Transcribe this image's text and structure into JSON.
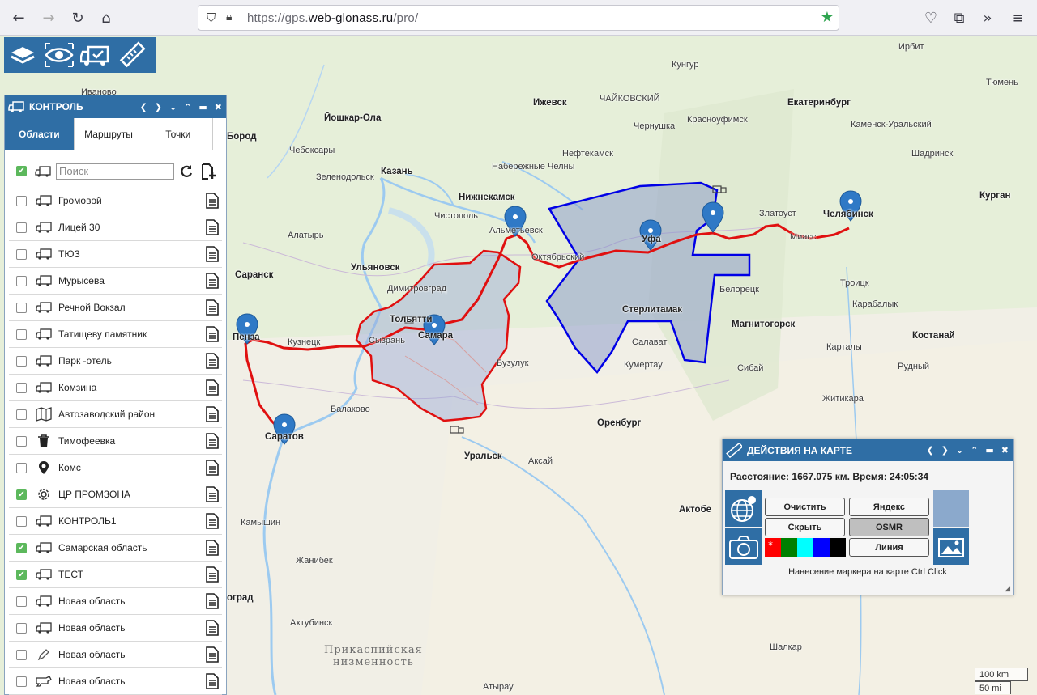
{
  "browser": {
    "url_prefix": "https://gps.",
    "url_domain": "web-glonass.ru",
    "url_path": "/pro/"
  },
  "map": {
    "cities": [
      {
        "name": "Кунгур"
      },
      {
        "name": "Ирбит"
      },
      {
        "name": "Тюмень"
      },
      {
        "name": "Ижевск"
      },
      {
        "name": "ЧАЙКОВСКИЙ"
      },
      {
        "name": "Екатеринбург"
      },
      {
        "name": "Йошкар-Ола"
      },
      {
        "name": "Чернушка"
      },
      {
        "name": "Красноуфимск"
      },
      {
        "name": "Каменск-Уральский"
      },
      {
        "name": "Чебоксары"
      },
      {
        "name": "Набережные Челны"
      },
      {
        "name": "Нефтекамск"
      },
      {
        "name": "Шадринск"
      },
      {
        "name": "Казань"
      },
      {
        "name": "Зеленодольск"
      },
      {
        "name": "Нижнекамск"
      },
      {
        "name": "Курган"
      },
      {
        "name": "Чистополь"
      },
      {
        "name": "Златоуст"
      },
      {
        "name": "Челябинск"
      },
      {
        "name": "Альметьевск"
      },
      {
        "name": "Уфа"
      },
      {
        "name": "Миасс"
      },
      {
        "name": "Алатырь"
      },
      {
        "name": "Октябрьский"
      },
      {
        "name": "Саранск"
      },
      {
        "name": "Ульяновск"
      },
      {
        "name": "Димитровград"
      },
      {
        "name": "Белорецк"
      },
      {
        "name": "Троицк"
      },
      {
        "name": "Стерлитамак"
      },
      {
        "name": "Тольятти"
      },
      {
        "name": "Самара"
      },
      {
        "name": "Магнитогорск"
      },
      {
        "name": "Карабалык"
      },
      {
        "name": "Пенза"
      },
      {
        "name": "Кузнецк"
      },
      {
        "name": "Сызрань"
      },
      {
        "name": "Салават"
      },
      {
        "name": "Костанай"
      },
      {
        "name": "Карталы"
      },
      {
        "name": "Бузулук"
      },
      {
        "name": "Кумертау"
      },
      {
        "name": "Сибай"
      },
      {
        "name": "Рудный"
      },
      {
        "name": "Балаково"
      },
      {
        "name": "Житикара"
      },
      {
        "name": "Саратов"
      },
      {
        "name": "Оренбург"
      },
      {
        "name": "Уральск"
      },
      {
        "name": "Аксай"
      },
      {
        "name": "Актобе"
      },
      {
        "name": "Камышин"
      },
      {
        "name": "Жанибек"
      },
      {
        "name": "Ахтубинск"
      },
      {
        "name": "Шалкар"
      },
      {
        "name": "Атырау"
      },
      {
        "name": "Бород"
      },
      {
        "name": "Иваново"
      },
      {
        "name": "оград"
      }
    ],
    "lowland_line1": "Прикаспийская",
    "lowland_line2": "низменность",
    "scale_km": "100 km",
    "scale_mi": "50 mi"
  },
  "toolbar": {
    "icons": [
      "layers-icon",
      "eye-icon",
      "truck-check-icon",
      "ruler-icon"
    ]
  },
  "control_panel": {
    "title": "КОНТРОЛЬ",
    "tabs": [
      "Области",
      "Маршруты",
      "Точки"
    ],
    "active_tab": "Области",
    "search_placeholder": "Поиск",
    "items": [
      {
        "label": "Громовой",
        "checked": false,
        "icon": "truck-icon"
      },
      {
        "label": "Лицей 30",
        "checked": false,
        "icon": "truck-icon"
      },
      {
        "label": "ТЮЗ",
        "checked": false,
        "icon": "truck-icon"
      },
      {
        "label": "Мурысева",
        "checked": false,
        "icon": "truck-icon"
      },
      {
        "label": "Речной Вокзал",
        "checked": false,
        "icon": "truck-icon"
      },
      {
        "label": "Татищеву памятник",
        "checked": false,
        "icon": "truck-icon"
      },
      {
        "label": "Парк -отель",
        "checked": false,
        "icon": "truck-icon"
      },
      {
        "label": "Комзина",
        "checked": false,
        "icon": "truck-icon"
      },
      {
        "label": "Автозаводский район",
        "checked": false,
        "icon": "map-icon"
      },
      {
        "label": "Тимофеевка",
        "checked": false,
        "icon": "trash-icon"
      },
      {
        "label": "Комс",
        "checked": false,
        "icon": "pin-icon"
      },
      {
        "label": "ЦР ПРОМЗОНА",
        "checked": true,
        "icon": "gear-icon"
      },
      {
        "label": "КОНТРОЛЬ1",
        "checked": false,
        "icon": "truck-icon"
      },
      {
        "label": "Самарская область",
        "checked": true,
        "icon": "truck-icon"
      },
      {
        "label": "ТЕСТ",
        "checked": true,
        "icon": "truck-icon"
      },
      {
        "label": "Новая область",
        "checked": false,
        "icon": "truck-icon"
      },
      {
        "label": "Новая область",
        "checked": false,
        "icon": "truck-icon"
      },
      {
        "label": "Новая область",
        "checked": false,
        "icon": "pencil-icon"
      },
      {
        "label": "Новая область",
        "checked": false,
        "icon": "camera-icon"
      }
    ]
  },
  "actions_panel": {
    "title": "ДЕЙСТВИЯ НА КАРТЕ",
    "info": "Расстояние: 1667.075 км. Время: 24:05:34",
    "buttons": {
      "clear": "Очистить",
      "yandex": "Яндекс",
      "hide": "Скрыть",
      "osmr": "OSMR",
      "line": "Линия"
    },
    "selected_router": "OSMR",
    "colors": [
      "#ff0000",
      "#008000",
      "#00ffff",
      "#0000ff",
      "#000000"
    ],
    "hint": "Нанесение маркера на карте Ctrl Click"
  }
}
